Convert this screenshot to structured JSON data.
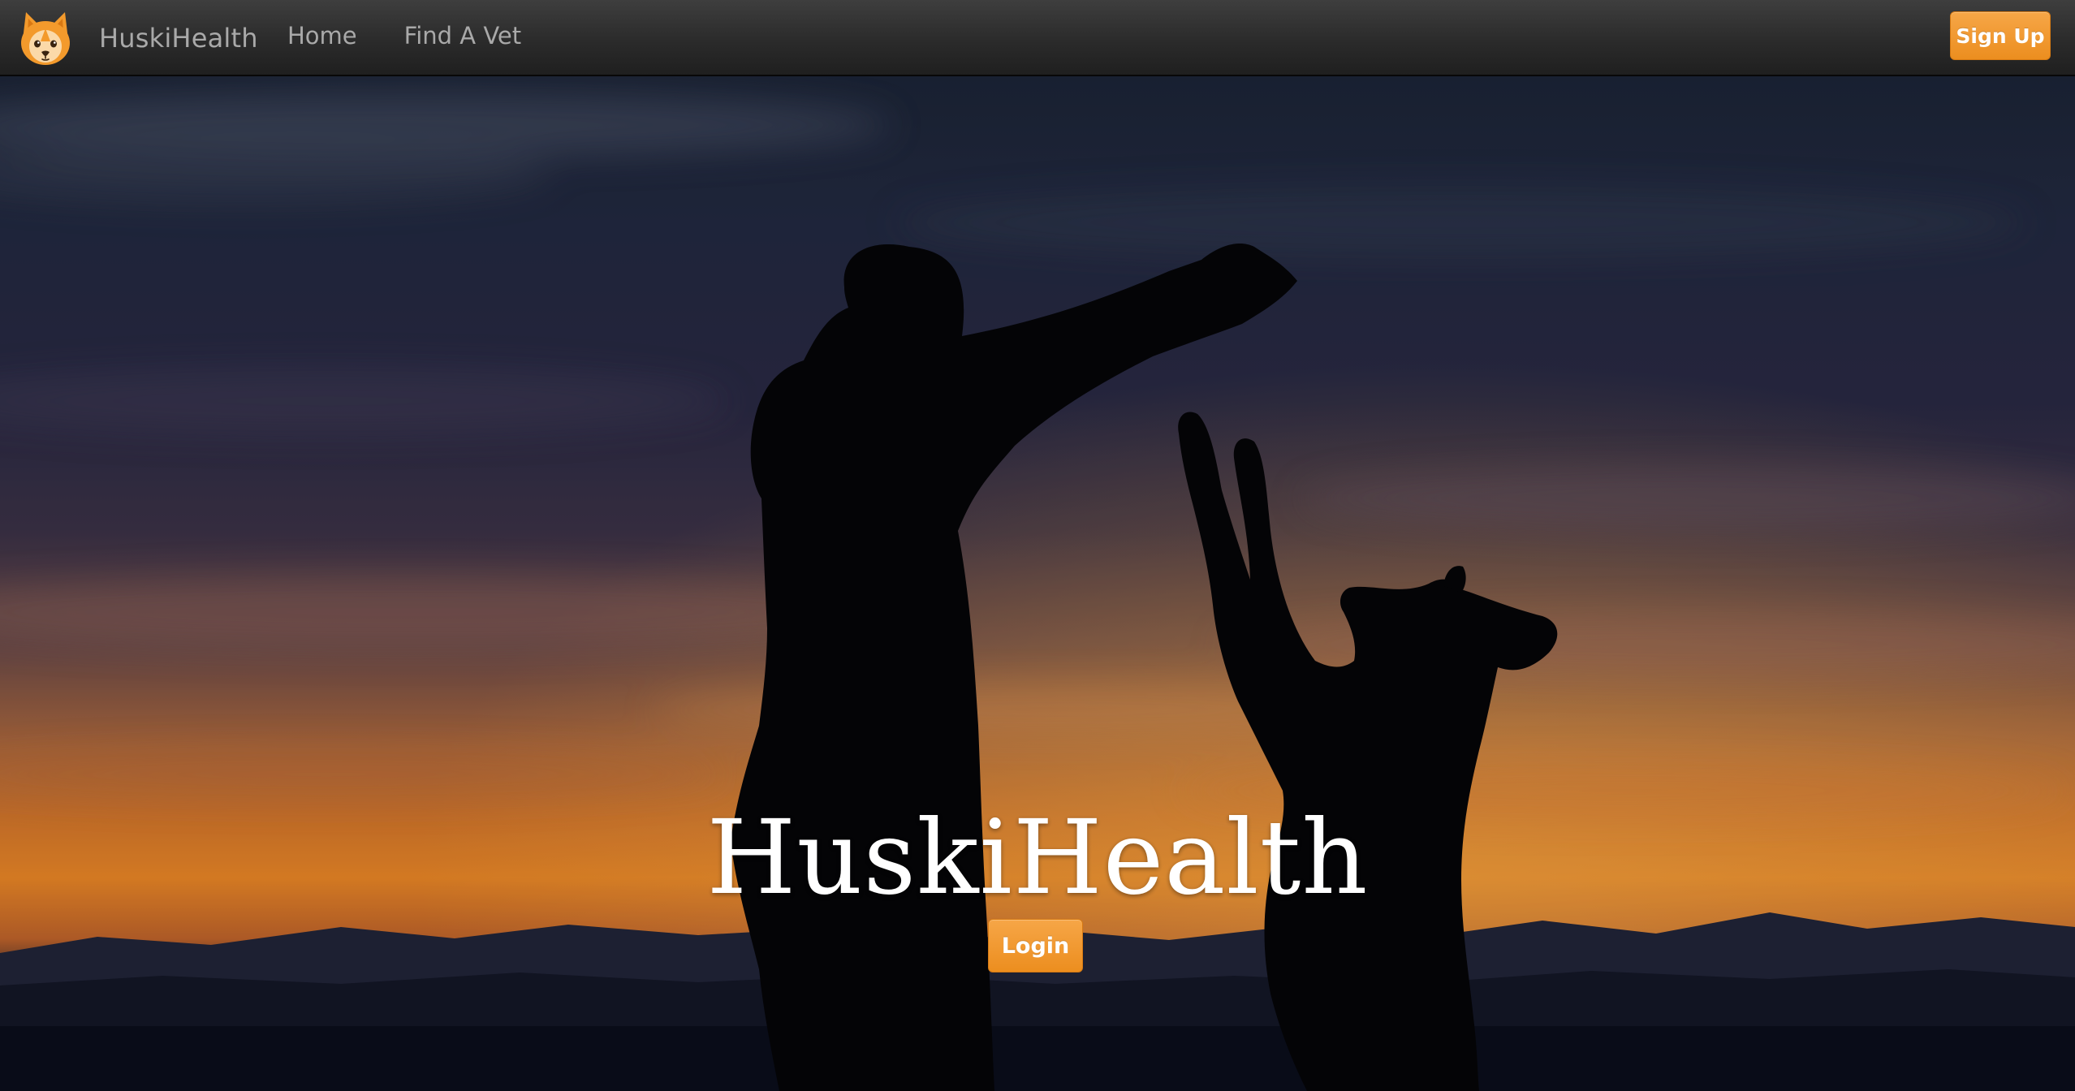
{
  "navbar": {
    "brand_name": "HuskiHealth",
    "logo_icon": "husky-face-icon",
    "links": [
      {
        "label": "Home"
      },
      {
        "label": "Find A Vet"
      }
    ],
    "signup_label": "Sign Up"
  },
  "hero": {
    "title": "HuskiHealth",
    "login_label": "Login",
    "background": "sunset-silhouette-person-and-dog"
  },
  "colors": {
    "accent_orange": "#f0962b",
    "navbar_dark": "#2b2b2b",
    "nav_text": "#a9a9a9"
  }
}
